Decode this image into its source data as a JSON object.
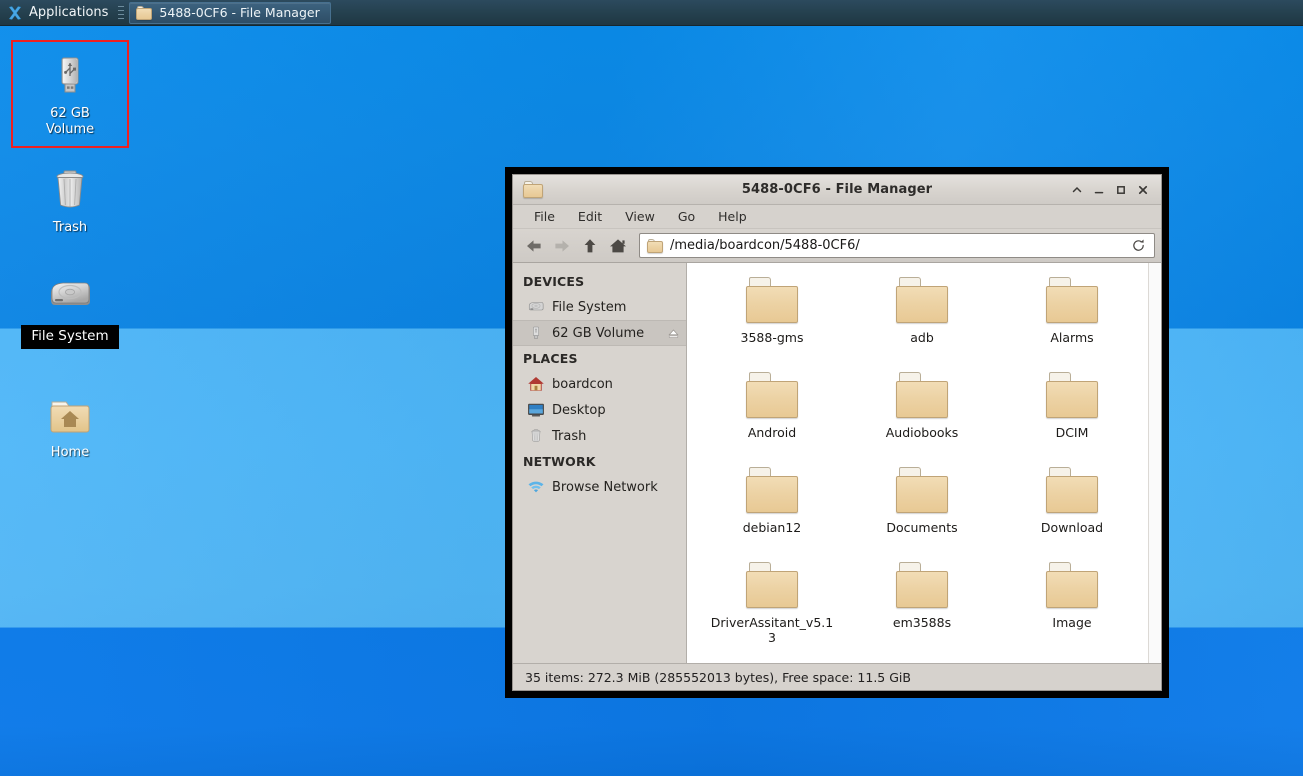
{
  "taskbar": {
    "applications_label": "Applications",
    "xfce_icon": "xfce-x-logo",
    "window_button": {
      "icon": "folder-icon",
      "label": "5488-0CF6 - File Manager"
    }
  },
  "desktop": {
    "icons": [
      {
        "name": "usb-volume",
        "icon": "usb-drive-icon",
        "label": "62 GB\nVolume",
        "label_line1": "62 GB",
        "label_line2": "Volume",
        "selected": true,
        "highlight_color": "#ef2020"
      },
      {
        "name": "trash",
        "icon": "trash-can-icon",
        "label": "Trash"
      },
      {
        "name": "file-system",
        "icon": "hard-disk-icon",
        "label": "File System",
        "label_highlighted": true
      },
      {
        "name": "home",
        "icon": "home-folder-icon",
        "label": "Home"
      }
    ],
    "wallpaper_colors": [
      "#0a8ceb",
      "#4bb4f7",
      "#0b7ae8"
    ]
  },
  "window": {
    "title": "5488-0CF6 - File Manager",
    "title_icon": "folder-icon",
    "buttons": {
      "shade": "⌃",
      "minimize": "＿",
      "maximize": "□",
      "close": "✕"
    },
    "menubar": [
      {
        "name": "file",
        "label": "File"
      },
      {
        "name": "edit",
        "label": "Edit"
      },
      {
        "name": "view",
        "label": "View"
      },
      {
        "name": "go",
        "label": "Go"
      },
      {
        "name": "help",
        "label": "Help"
      }
    ],
    "toolbar": {
      "back": {
        "icon": "arrow-left-icon",
        "enabled": true
      },
      "forward": {
        "icon": "arrow-right-icon",
        "enabled": false
      },
      "up": {
        "icon": "arrow-up-icon",
        "enabled": true
      },
      "home": {
        "icon": "home-icon",
        "enabled": true
      },
      "path_icon": "folder-icon",
      "path_value": "/media/boardcon/5488-0CF6/",
      "path_placeholder": "Location",
      "reload": {
        "icon": "reload-icon"
      }
    },
    "sidebar": {
      "sections": [
        {
          "title": "DEVICES",
          "items": [
            {
              "name": "file-system",
              "icon": "hard-disk-icon",
              "label": "File System",
              "selected": false,
              "eject": false
            },
            {
              "name": "62-gb-volume",
              "icon": "usb-drive-icon",
              "label": "62 GB Volume",
              "selected": true,
              "eject": true
            }
          ]
        },
        {
          "title": "PLACES",
          "items": [
            {
              "name": "boardcon",
              "icon": "home-icon",
              "label": "boardcon",
              "selected": false,
              "eject": false
            },
            {
              "name": "desktop",
              "icon": "desktop-icon",
              "label": "Desktop",
              "selected": false,
              "eject": false
            },
            {
              "name": "trash",
              "icon": "trash-can-icon",
              "label": "Trash",
              "selected": false,
              "eject": false
            }
          ]
        },
        {
          "title": "NETWORK",
          "items": [
            {
              "name": "browse-network",
              "icon": "network-wifi-icon",
              "label": "Browse Network",
              "selected": false,
              "eject": false
            }
          ]
        }
      ]
    },
    "files": [
      {
        "name": "3588-gms",
        "label": "3588-gms",
        "icon": "folder-icon"
      },
      {
        "name": "adb",
        "label": "adb",
        "icon": "folder-icon"
      },
      {
        "name": "alarms",
        "label": "Alarms",
        "icon": "folder-icon"
      },
      {
        "name": "android",
        "label": "Android",
        "icon": "folder-icon"
      },
      {
        "name": "audiobooks",
        "label": "Audiobooks",
        "icon": "folder-icon"
      },
      {
        "name": "dcim",
        "label": "DCIM",
        "icon": "folder-icon"
      },
      {
        "name": "debian12",
        "label": "debian12",
        "icon": "folder-icon"
      },
      {
        "name": "documents",
        "label": "Documents",
        "icon": "folder-icon"
      },
      {
        "name": "download",
        "label": "Download",
        "icon": "folder-icon"
      },
      {
        "name": "driverassitant",
        "label": "DriverAssitant_v5.13",
        "icon": "folder-icon"
      },
      {
        "name": "em3588s",
        "label": "em3588s",
        "icon": "folder-icon"
      },
      {
        "name": "image",
        "label": "Image",
        "icon": "folder-icon"
      }
    ],
    "statusbar": "35 items: 272.3 MiB (285552013 bytes), Free space: 11.5 GiB"
  }
}
